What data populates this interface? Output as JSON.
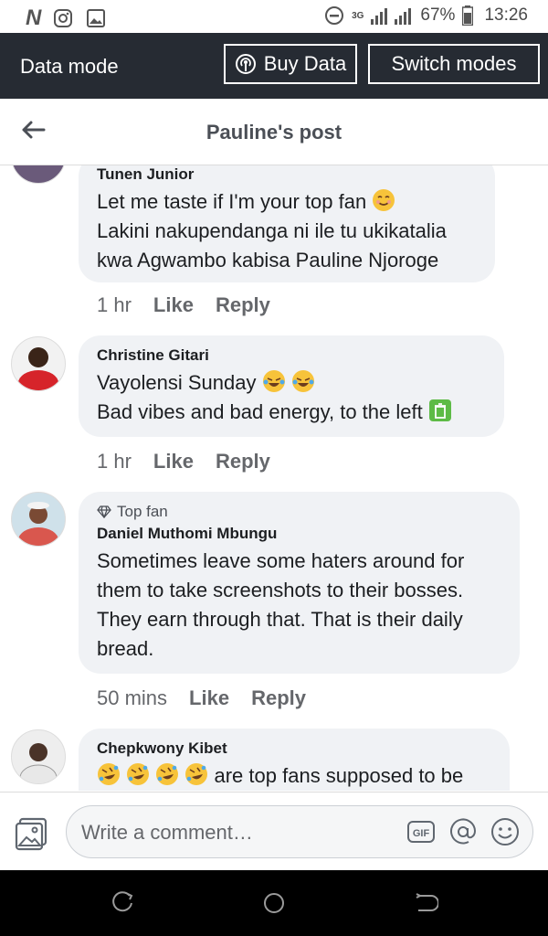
{
  "status_bar": {
    "network": "3G",
    "battery": "67%",
    "time": "13:26"
  },
  "data_bar": {
    "title": "Data mode",
    "buy_label": "Buy Data",
    "switch_label": "Switch modes"
  },
  "header": {
    "title": "Pauline's post"
  },
  "comments": [
    {
      "name": "Tunen Junior",
      "lines": [
        "Let me taste if I'm your top fan",
        "Lakini nakupendanga ni ile tu ukikatalia",
        "kwa Agwambo kabisa Pauline Njoroge"
      ],
      "time": "1 hr",
      "like": "Like",
      "reply": "Reply"
    },
    {
      "name": "Christine Gitari",
      "lines": [
        "Vayolensi Sunday",
        "Bad vibes and bad energy, to the left"
      ],
      "time": "1 hr",
      "like": "Like",
      "reply": "Reply"
    },
    {
      "badge": "Top fan",
      "name": "Daniel Muthomi Mbungu",
      "lines": [
        "Sometimes leave some haters around for",
        "them to take screenshots to their bosses.",
        "They earn through that. That is their daily",
        "bread."
      ],
      "time": "50 mins",
      "like": "Like",
      "reply": "Reply"
    },
    {
      "name": "Chepkwony Kibet",
      "lines": [
        "are top fans supposed to be"
      ]
    }
  ],
  "composer": {
    "placeholder": "Write a comment…",
    "gif_label": "GIF"
  },
  "colors": {
    "data_bar_bg": "#262b33",
    "bubble_bg": "#f0f2f5",
    "meta_text": "#65676b"
  }
}
